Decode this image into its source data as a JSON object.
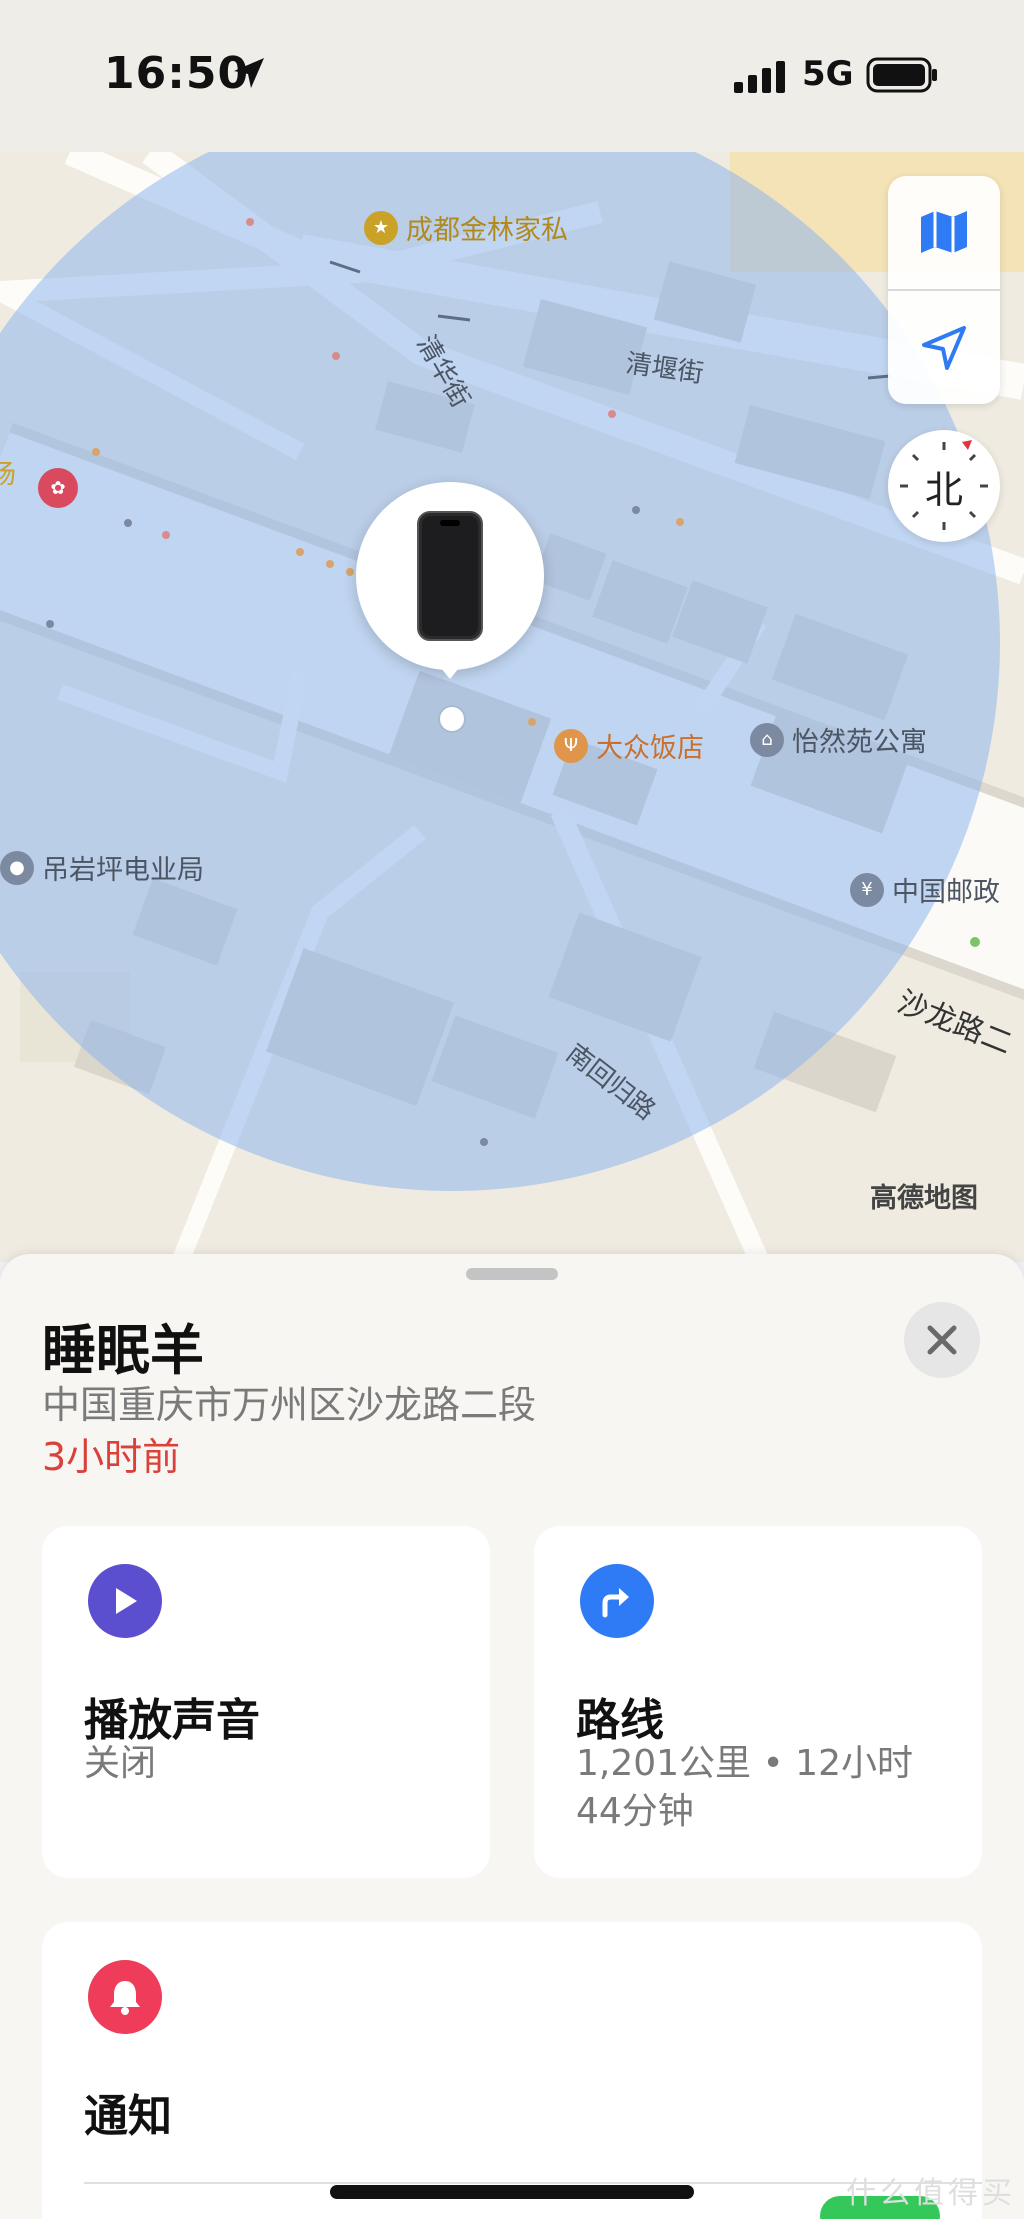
{
  "status_bar": {
    "time": "16:50",
    "network": "5G",
    "icons": [
      "location-arrow-icon",
      "signal-bars-icon",
      "battery-icon"
    ]
  },
  "map": {
    "road_labels": [
      "清华街",
      "清堰街",
      "南回归路",
      "沙龙路二"
    ],
    "pois": [
      {
        "label": "成都金林家私",
        "icon": "furniture-icon",
        "color": "#c9a227"
      },
      {
        "label": "大众饭店",
        "icon": "fork-knife-icon",
        "color": "#d98b3a"
      },
      {
        "label": "怡然苑公寓",
        "icon": "house-icon",
        "color": "#7b8aa0"
      },
      {
        "label": "吊岩坪电业局",
        "icon": "building-icon",
        "color": "#7b8aa0"
      },
      {
        "label": "中国邮政",
        "icon": "post-icon",
        "color": "#7b8aa0"
      }
    ],
    "left_edge_label": "场",
    "compass_label": "北",
    "credit": "高德地图",
    "controls": [
      "map-mode-icon",
      "locate-arrow-icon"
    ],
    "accuracy_circle_color": "#a9c6ef"
  },
  "device": {
    "name": "睡眠羊",
    "address": "中国重庆市万州区沙龙路二段",
    "last_seen": "3小时前"
  },
  "actions": {
    "play_sound": {
      "title": "播放声音",
      "status": "关闭",
      "icon": "play-icon",
      "color": "#5b4fcf"
    },
    "directions": {
      "title": "路线",
      "line1": "1,201公里 • 12小时",
      "line2": "44分钟",
      "icon": "turn-right-arrow-icon",
      "color": "#2f7bf5"
    },
    "notifications": {
      "title": "通知",
      "icon": "bell-icon",
      "color": "#ee3c5a"
    }
  },
  "watermark": "什么值得买"
}
